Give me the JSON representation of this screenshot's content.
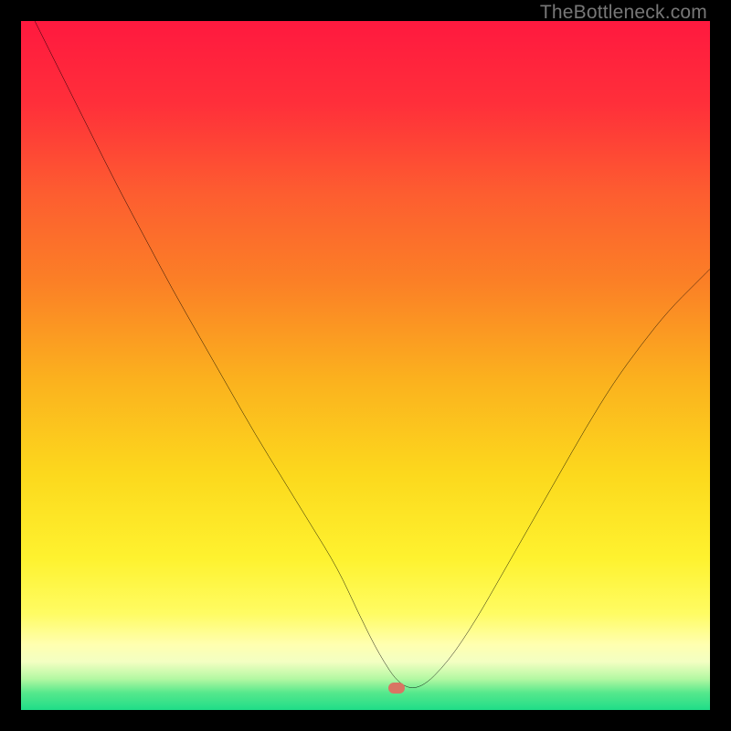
{
  "watermark": "TheBottleneck.com",
  "marker": {
    "x_pct": 54.5,
    "y_pct": 96.8
  },
  "gradient_stops": [
    {
      "offset": 0.0,
      "color": "#ff193f"
    },
    {
      "offset": 0.12,
      "color": "#ff2f3a"
    },
    {
      "offset": 0.25,
      "color": "#fd5d30"
    },
    {
      "offset": 0.38,
      "color": "#fb8026"
    },
    {
      "offset": 0.52,
      "color": "#fbb11e"
    },
    {
      "offset": 0.66,
      "color": "#fcd91d"
    },
    {
      "offset": 0.78,
      "color": "#fef22f"
    },
    {
      "offset": 0.86,
      "color": "#fffc63"
    },
    {
      "offset": 0.905,
      "color": "#ffffb0"
    },
    {
      "offset": 0.93,
      "color": "#f3ffc2"
    },
    {
      "offset": 0.955,
      "color": "#b3f8a2"
    },
    {
      "offset": 0.975,
      "color": "#56e88c"
    },
    {
      "offset": 1.0,
      "color": "#1fdd88"
    }
  ],
  "chart_data": {
    "type": "line",
    "title": "",
    "xlabel": "",
    "ylabel": "",
    "xlim": [
      0,
      100
    ],
    "ylim": [
      0,
      100
    ],
    "series": [
      {
        "name": "bottleneck-curve",
        "x": [
          2,
          6,
          10,
          14,
          18,
          22,
          26,
          30,
          34,
          38,
          42,
          46,
          49,
          52,
          55,
          58,
          62,
          66,
          70,
          74,
          78,
          82,
          86,
          90,
          94,
          98,
          100
        ],
        "values": [
          100,
          92,
          84,
          76,
          68.5,
          61,
          54,
          47,
          40,
          33.5,
          27,
          20.5,
          14,
          8,
          3.5,
          3,
          7,
          13,
          20,
          27,
          34,
          41,
          47.5,
          53,
          58,
          62,
          64
        ]
      }
    ],
    "annotations": [
      {
        "name": "optimal-point",
        "x": 56,
        "y": 3
      }
    ]
  }
}
